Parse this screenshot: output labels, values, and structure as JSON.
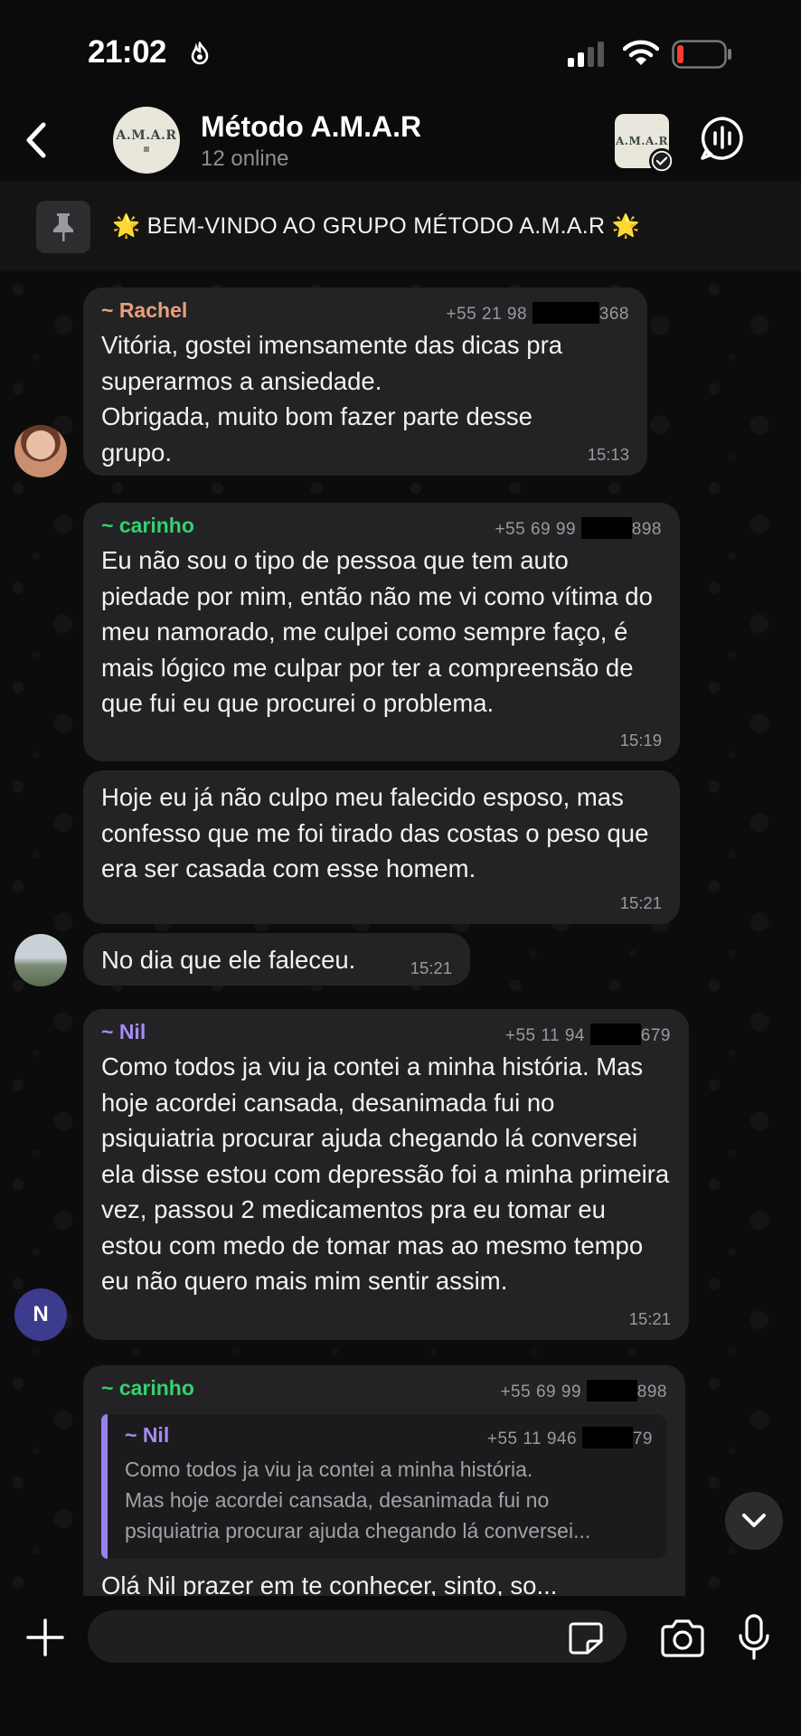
{
  "status_bar": {
    "time": "21:02"
  },
  "header": {
    "title": "Método A.M.A.R",
    "subtitle": "12 online",
    "logo_text": "A.M.A.R"
  },
  "pinned": {
    "text": "🌟 BEM-VINDO AO GRUPO MÉTODO A.M.A.R 🌟"
  },
  "messages": [
    {
      "sender": "~ Rachel",
      "phone_prefix": "+55 21 98",
      "phone_suffix": "368",
      "text": "Vitória, gostei imensamente das dicas pra superarmos a ansiedade.\nObrigada, muito bom fazer parte desse grupo.",
      "time": "15:13"
    },
    {
      "sender": "~ carinho",
      "phone_prefix": "+55 69 99",
      "phone_suffix": "898",
      "text": "Eu não sou o tipo de pessoa que tem auto piedade por mim, então não me vi como vítima do meu namorado, me culpei como sempre faço, é mais lógico me culpar por ter a compreensão de que fui eu que procurei o problema.",
      "time": "15:19"
    },
    {
      "text": "Hoje eu já não culpo meu falecido esposo, mas confesso que me foi tirado das costas o peso que era ser casada com esse homem.",
      "time": "15:21"
    },
    {
      "text": "No dia que ele faleceu.",
      "time": "15:21"
    },
    {
      "sender": "~ Nil",
      "phone_prefix": "+55 11 94",
      "phone_suffix": "679",
      "text": "Como todos ja viu ja contei a minha história. Mas hoje acordei cansada, desanimada fui no psiquiatria procurar ajuda chegando lá conversei ela disse estou com depressão foi a minha primeira vez, passou 2 medicamentos pra eu tomar eu estou com medo de tomar mas ao mesmo tempo eu não quero mais mim sentir assim.",
      "time": "15:21",
      "avatar_letter": "N"
    },
    {
      "sender": "~ carinho",
      "phone_prefix": "+55 69 99",
      "phone_suffix": "898",
      "reply": {
        "sender": "~ Nil",
        "phone_prefix": "+55 11 946",
        "phone_suffix": "79",
        "text": "Como todos ja viu ja contei a minha história.\nMas hoje acordei cansada, desanimada fui no\npsiquiatria procurar ajuda chegando lá conversei..."
      },
      "text_partial": "Olá Nil prazer em te conhecer, sinto, so..."
    }
  ],
  "icons": {
    "back": "chevron-left-icon",
    "pin": "pin-icon",
    "voice_chat": "voice-chat-icon",
    "attach": "plus-icon",
    "sticker": "sticker-icon",
    "camera": "camera-icon",
    "mic": "microphone-icon",
    "scroll_down": "chevron-down-icon"
  },
  "colors": {
    "rachel": "#e8a07a",
    "carinho": "#35d170",
    "nil": "#a78bf0",
    "bubble": "#232325",
    "avatar_n": "#3d3b8e"
  }
}
